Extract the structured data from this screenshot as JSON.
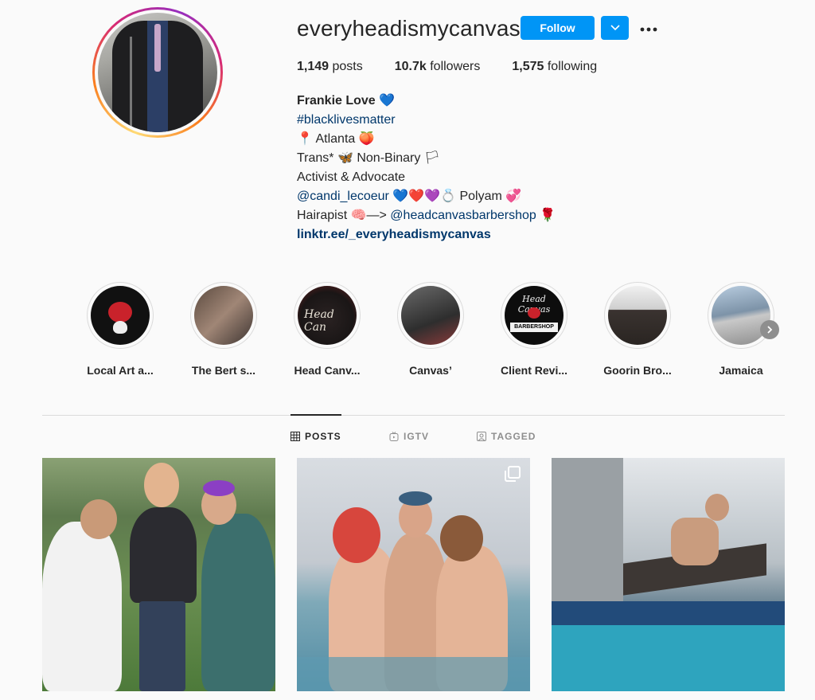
{
  "profile": {
    "username": "everyheadismycanvas",
    "follow_label": "Follow",
    "dropdown_icon": "chevron-down-icon",
    "more_icon": "more-options-icon"
  },
  "stats": {
    "posts_count": "1,149",
    "posts_label": " posts",
    "followers_count": "10.7k",
    "followers_label": " followers",
    "following_count": "1,575",
    "following_label": " following"
  },
  "bio": {
    "name": "Frankie Love 💙",
    "hashtag": "#blacklivesmatter",
    "location": "📍 Atlanta 🍑",
    "identity": "Trans* 🦋 Non-Binary 🏳",
    "role": "Activist & Advocate",
    "partner_handle": "@candi_lecoeur",
    "partner_suffix": " 💙❤️💜💍 Polyam 💞",
    "hair_prefix": "Hairapist 🧠—> ",
    "hair_handle": "@headcanvasbarbershop",
    "hair_suffix": " 🌹",
    "url": "linktr.ee/_everyheadismycanvas"
  },
  "highlights": [
    {
      "label": "Local Art a..."
    },
    {
      "label": "The Bert s..."
    },
    {
      "label": "Head Canv..."
    },
    {
      "label": "Canvas’"
    },
    {
      "label": "Client Revi..."
    },
    {
      "label": "Goorin Bro..."
    },
    {
      "label": "Jamaica"
    }
  ],
  "highlight_art": {
    "head_canvas_text": "Head Can",
    "badge_title": "Head Canvas",
    "badge_shop": "BARBERSHOP"
  },
  "tabs": [
    {
      "label": "POSTS",
      "icon": "grid-icon",
      "active": true
    },
    {
      "label": "IGTV",
      "icon": "igtv-icon",
      "active": false
    },
    {
      "label": "TAGGED",
      "icon": "tagged-icon",
      "active": false
    }
  ],
  "posts": [
    {
      "icon": ""
    },
    {
      "icon": "multiple-photos-icon"
    },
    {
      "icon": ""
    }
  ],
  "colors": {
    "follow_blue": "#0095f6",
    "link_blue": "#00376b",
    "background": "#fafafa",
    "text": "#262626",
    "muted": "#8e8e8e"
  }
}
